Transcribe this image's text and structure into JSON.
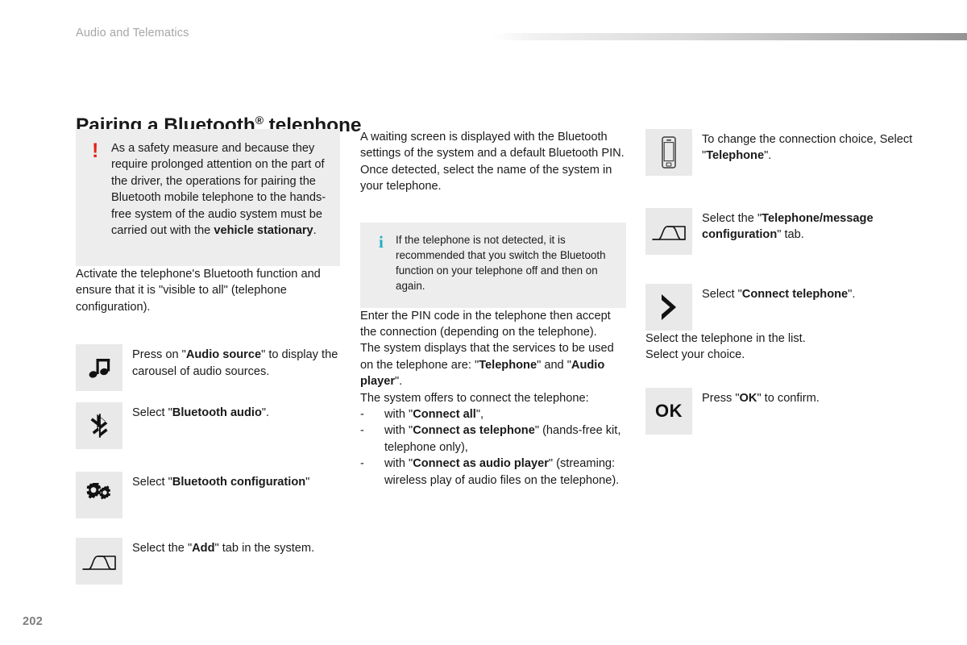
{
  "header": {
    "chapter": "Audio and Telematics"
  },
  "title": {
    "main": "Pairing a Bluetooth",
    "sup": "®",
    "tail": " telephone"
  },
  "footer": {
    "page_number": "202"
  },
  "colors": {
    "warning_red": "#e2231a",
    "info_teal": "#22aec4",
    "callout_bg": "#ededed",
    "icon_box_bg": "#e9e9e9",
    "header_text": "#a6a6a6",
    "page_number": "#7d7d7d"
  },
  "column_left": {
    "warning": {
      "mark": "!",
      "text_parts": [
        {
          "t": "As a safety measure and because they require prolonged attention on the part of the driver, the operations for pairing the Bluetooth mobile telephone to the hands-free system of the audio system must be carried out with the ",
          "b": false
        },
        {
          "t": "vehicle stationary",
          "b": true
        },
        {
          "t": ".",
          "b": false
        }
      ]
    },
    "paragraph_activate": "Activate the telephone's Bluetooth function and ensure that it is \"visible to all\" (telephone configuration).",
    "steps": [
      {
        "icon": "music-note-icon",
        "text_parts": [
          {
            "t": "Press on \"",
            "b": false
          },
          {
            "t": "Audio source",
            "b": true
          },
          {
            "t": "\" to display the carousel of audio sources.",
            "b": false
          }
        ]
      },
      {
        "icon": "bluetooth-icon",
        "text_parts": [
          {
            "t": "Select \"",
            "b": false
          },
          {
            "t": "Bluetooth audio",
            "b": true
          },
          {
            "t": "\".",
            "b": false
          }
        ]
      },
      {
        "icon": "gears-icon",
        "text_parts": [
          {
            "t": "Select \"",
            "b": false
          },
          {
            "t": "Bluetooth configuration",
            "b": true
          },
          {
            "t": "\"",
            "b": false
          }
        ]
      },
      {
        "icon": "tab-icon",
        "text_parts": [
          {
            "t": "Select the \"",
            "b": false
          },
          {
            "t": "Add",
            "b": true
          },
          {
            "t": "\" tab in the system.",
            "b": false
          }
        ]
      }
    ]
  },
  "column_middle": {
    "paragraph_waiting": "A waiting screen is displayed with the Bluetooth settings of the system and a default Bluetooth PIN.",
    "paragraph_detected": "Once detected, select the name of the system in your telephone.",
    "info": {
      "mark": "i",
      "text": "If the telephone is not detected, it is recommended that you switch the Bluetooth function on your telephone off and then on again."
    },
    "paragraph_pin": "Enter the PIN code in the telephone then accept the connection (depending on the telephone).",
    "paragraph_services_parts": [
      {
        "t": "The system displays that the services to be used on the telephone are: \"",
        "b": false
      },
      {
        "t": "Telephone",
        "b": true
      },
      {
        "t": "\" and \"",
        "b": false
      },
      {
        "t": "Audio player",
        "b": true
      },
      {
        "t": "\".",
        "b": false
      }
    ],
    "offers_intro": "The system offers to connect the telephone:",
    "offers": [
      {
        "dash": "-",
        "parts": [
          {
            "t": "with \"",
            "b": false
          },
          {
            "t": "Connect all",
            "b": true
          },
          {
            "t": "\",",
            "b": false
          }
        ]
      },
      {
        "dash": "-",
        "parts": [
          {
            "t": "with \"",
            "b": false
          },
          {
            "t": "Connect as telephone",
            "b": true
          },
          {
            "t": "\" (hands-free kit, telephone only),",
            "b": false
          }
        ]
      },
      {
        "dash": "-",
        "parts": [
          {
            "t": "with \"",
            "b": false
          },
          {
            "t": "Connect as audio player",
            "b": true
          },
          {
            "t": "\" (streaming: wireless play of audio files on the telephone).",
            "b": false
          }
        ]
      }
    ]
  },
  "column_right": {
    "steps_top": [
      {
        "icon": "smartphone-icon",
        "text_parts": [
          {
            "t": "To change the connection choice, Select \"",
            "b": false
          },
          {
            "t": "Telephone",
            "b": true
          },
          {
            "t": "\".",
            "b": false
          }
        ]
      },
      {
        "icon": "tab-icon",
        "text_parts": [
          {
            "t": "Select the \"",
            "b": false
          },
          {
            "t": "Telephone/message configuration",
            "b": true
          },
          {
            "t": "\" tab.",
            "b": false
          }
        ]
      },
      {
        "icon": "chevron-right-icon",
        "text_parts": [
          {
            "t": "Select \"",
            "b": false
          },
          {
            "t": "Connect telephone",
            "b": true
          },
          {
            "t": "\".",
            "b": false
          }
        ]
      }
    ],
    "paragraph_select_list": "Select the telephone in the list.",
    "paragraph_select_choice": "Select your choice.",
    "step_ok": {
      "icon": "ok-icon",
      "icon_label": "OK",
      "text_parts": [
        {
          "t": "Press \"",
          "b": false
        },
        {
          "t": "OK",
          "b": true
        },
        {
          "t": "\" to confirm.",
          "b": false
        }
      ]
    }
  }
}
